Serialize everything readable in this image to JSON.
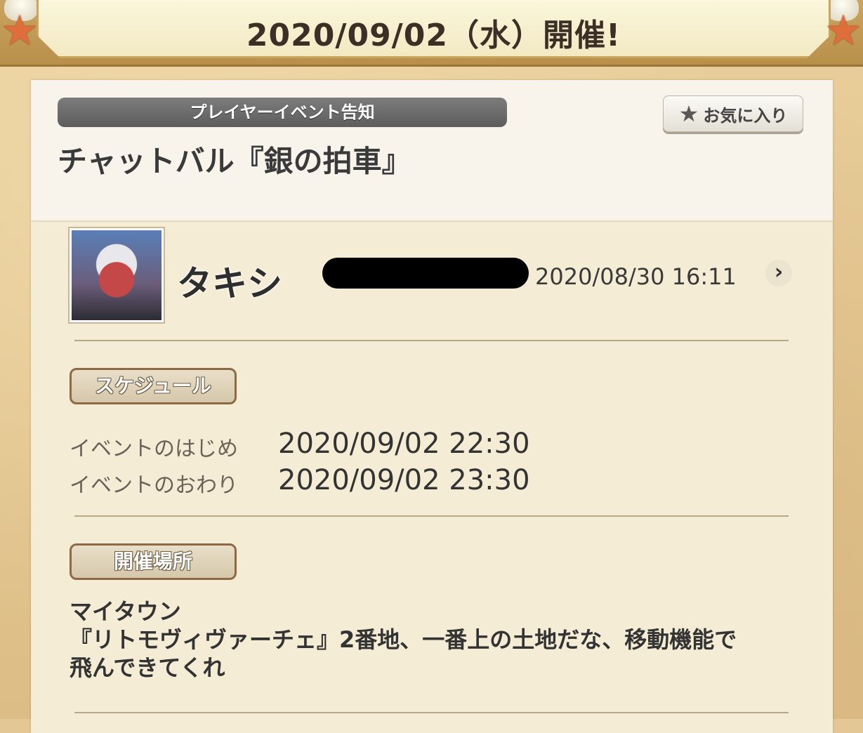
{
  "banner": {
    "title": "2020/09/02（水）開催!"
  },
  "card": {
    "category": "プレイヤーイベント告知",
    "favorite_label": "お気に入り",
    "event_title": "チャットバル『銀の拍車』"
  },
  "author": {
    "name": "タキシ",
    "posted_at": "2020/08/30 16:11"
  },
  "schedule": {
    "section_label": "スケジュール",
    "start_label": "イベントのはじめ",
    "start_value": "2020/09/02 22:30",
    "end_label": "イベントのおわり",
    "end_value": "2020/09/02 23:30"
  },
  "location": {
    "section_label": "開催場所",
    "line1": "マイタウン",
    "line2": "『リトモヴィヴァーチェ』2番地、一番上の土地だな、移動機能で",
    "line3": "飛んできてくれ"
  },
  "icons": {
    "favorite": "star-icon",
    "open_profile": "chevron-right-icon",
    "decor_left": "starfish-icon",
    "decor_right": "starfish-icon"
  },
  "colors": {
    "category_pill": "#6b6b6b",
    "card_bg": "#f5ecd6",
    "banner_bg": "#f8f1d3"
  }
}
